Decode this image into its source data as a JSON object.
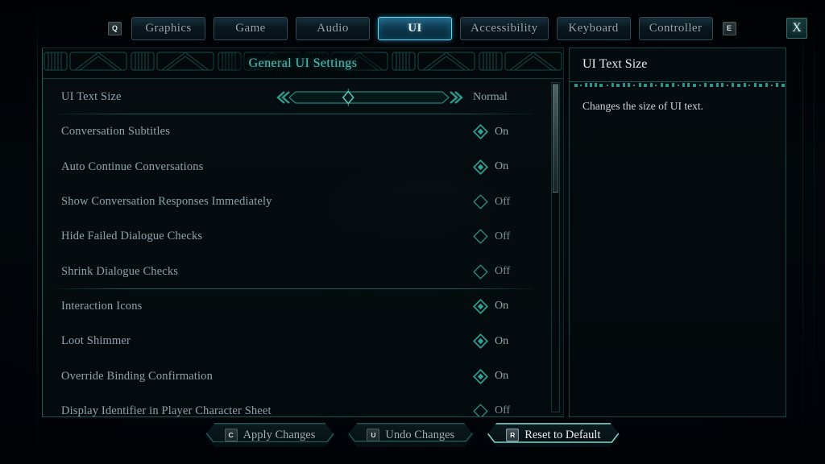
{
  "colors": {
    "accent_teal": "#2e9c8f",
    "accent_cyan": "#5fd8f5",
    "title_teal": "#53c2b6",
    "label_grey": "#8fa4ac",
    "bg": "#000205"
  },
  "topbar": {
    "prev_key": "Q",
    "next_key": "E",
    "close_label": "X",
    "tabs": [
      {
        "label": "Graphics",
        "active": false
      },
      {
        "label": "Game",
        "active": false
      },
      {
        "label": "Audio",
        "active": false
      },
      {
        "label": "UI",
        "active": true
      },
      {
        "label": "Accessibility",
        "active": false
      },
      {
        "label": "Keyboard",
        "active": false
      },
      {
        "label": "Controller",
        "active": false
      }
    ]
  },
  "panel": {
    "title": "General UI Settings",
    "settings": [
      {
        "label": "UI Text Size",
        "type": "slider",
        "value_label": "Normal",
        "fill_percent": 37,
        "separator_after": true
      },
      {
        "label": "Conversation Subtitles",
        "type": "toggle",
        "value": "On",
        "state": "on",
        "separator_after": false
      },
      {
        "label": "Auto Continue Conversations",
        "type": "toggle",
        "value": "On",
        "state": "on",
        "separator_after": false
      },
      {
        "label": "Show Conversation Responses Immediately",
        "type": "toggle",
        "value": "Off",
        "state": "off",
        "separator_after": false
      },
      {
        "label": "Hide Failed Dialogue Checks",
        "type": "toggle",
        "value": "Off",
        "state": "off",
        "separator_after": false
      },
      {
        "label": "Shrink Dialogue Checks",
        "type": "toggle",
        "value": "Off",
        "state": "off",
        "separator_after": true
      },
      {
        "label": "Interaction Icons",
        "type": "toggle",
        "value": "On",
        "state": "on",
        "separator_after": false
      },
      {
        "label": "Loot Shimmer",
        "type": "toggle",
        "value": "On",
        "state": "on",
        "separator_after": false
      },
      {
        "label": "Override Binding Confirmation",
        "type": "toggle",
        "value": "On",
        "state": "on",
        "separator_after": false
      },
      {
        "label": "Display Identifier in Player Character Sheet",
        "type": "toggle",
        "value": "Off",
        "state": "off",
        "separator_after": false
      }
    ],
    "scroll_thumb_percent": 33
  },
  "info": {
    "title": "UI Text Size",
    "description": "Changes the size of UI text."
  },
  "footer": {
    "buttons": [
      {
        "key": "C",
        "label": "Apply Changes",
        "highlight": false
      },
      {
        "key": "U",
        "label": "Undo Changes",
        "highlight": false
      },
      {
        "key": "R",
        "label": "Reset to Default",
        "highlight": true
      }
    ]
  }
}
